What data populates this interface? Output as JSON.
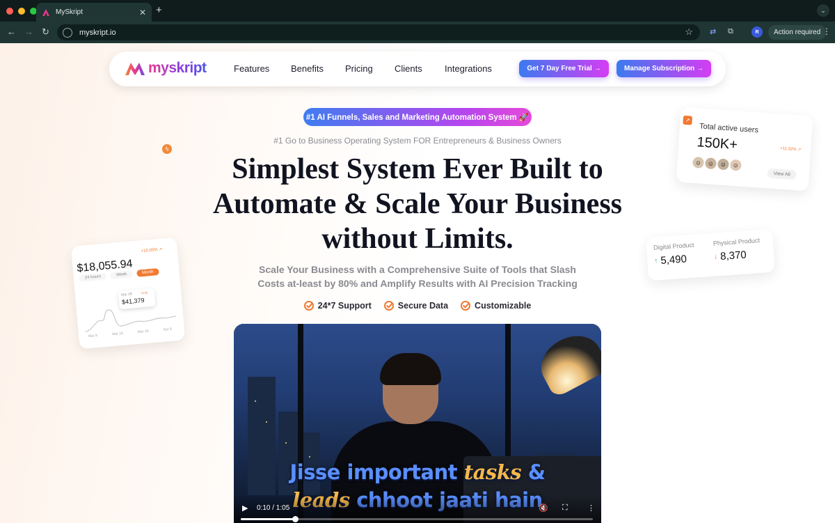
{
  "browser": {
    "tab_title": "MySkript",
    "new_tab": "+",
    "url": "myskript.io",
    "profile_initials": "R",
    "action_required": "Action required"
  },
  "nav": {
    "logo_text": "myskript",
    "links": [
      "Features",
      "Benefits",
      "Pricing",
      "Clients",
      "Integrations"
    ],
    "trial_button": "Get 7 Day Free Trial →",
    "subscription_button": "Manage Subscription →"
  },
  "hero": {
    "pill": "#1 AI Funnels, Sales and Marketing Automation System 🚀",
    "subtitle": "#1 Go to Business Operating System FOR Entrepreneurs & Business Owners",
    "headline_line1": "Simplest System Ever Built to",
    "headline_line2": "Automate & Scale Your Business",
    "headline_line3": "without Limits.",
    "desc_line1": "Scale Your Business with a Comprehensive Suite of Tools that Slash",
    "desc_line2": "Costs at-least by 80% and Amplify Results with AI Precision Tracking",
    "features": [
      "24*7 Support",
      "Secure Data",
      "Customizable"
    ]
  },
  "users_card": {
    "title": "Total active users",
    "value": "150K+",
    "growth": "+11.02% ↗",
    "view_all": "View All"
  },
  "money_card": {
    "value": "$18,055.94",
    "growth": "+10.05% ↗",
    "tabs": [
      "24 hours",
      "Week",
      "Month"
    ],
    "popup_date": "Mar 28",
    "popup_value": "$41,379",
    "popup_growth": "+8.05",
    "axis": [
      "Mar 8",
      "Mar 18",
      "Mar 28",
      "Apr 8"
    ]
  },
  "products_card": {
    "digital_label": "Digital Product",
    "digital_value": "5,490",
    "physical_label": "Physical Product",
    "physical_value": "8,370"
  },
  "video": {
    "caption_blue_1": "Jisse important ",
    "caption_gold_1": "tasks",
    "caption_blue_1b": " &",
    "caption_gold_2": "leads",
    "caption_blue_2": " chhoot jaati hain",
    "time": "0:10 / 1:05",
    "progress": 0.154
  }
}
